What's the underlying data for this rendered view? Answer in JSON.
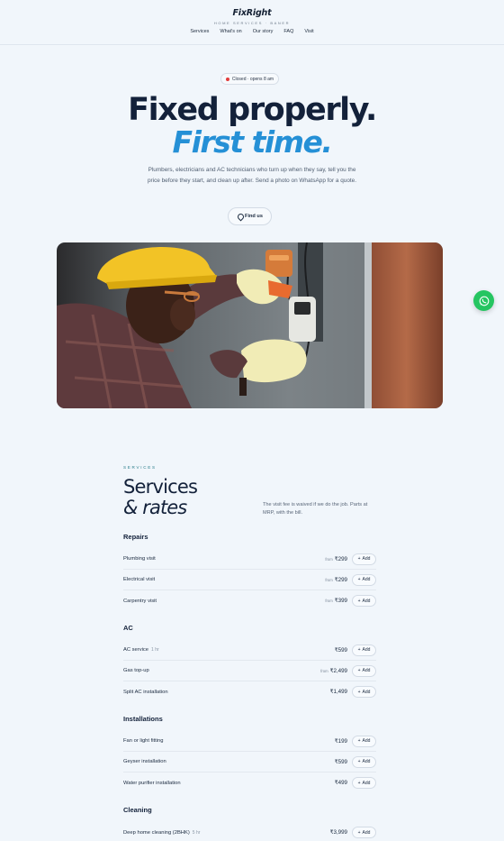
{
  "header": {
    "logo": "FixRight",
    "tagline": "HOME SERVICES · BANER",
    "nav": [
      "Services",
      "What's on",
      "Our story",
      "FAQ",
      "Visit"
    ]
  },
  "hero": {
    "status": "Closed · opens 8 am",
    "headline_1": "Fixed properly.",
    "headline_2": "First time.",
    "intro": "Plumbers, electricians and AC technicians who turn up when they say, tell you the price before they start, and clean up after. Send a photo on WhatsApp for a quote.",
    "find_us": "Find us"
  },
  "services": {
    "eyebrow": "SERVICES",
    "title_1": "Services",
    "title_2": "& rates",
    "note": "The visit fee is waived if we do the job. Parts at MRP, with the bill.",
    "add_label": "Add",
    "groups": [
      {
        "title": "Repairs",
        "items": [
          {
            "name": "Plumbing visit",
            "duration": "",
            "from": "from",
            "price": "₹299"
          },
          {
            "name": "Electrical visit",
            "duration": "",
            "from": "from",
            "price": "₹299"
          },
          {
            "name": "Carpentry visit",
            "duration": "",
            "from": "from",
            "price": "₹399"
          }
        ]
      },
      {
        "title": "AC",
        "items": [
          {
            "name": "AC service",
            "duration": "1 hr",
            "from": "",
            "price": "₹599"
          },
          {
            "name": "Gas top-up",
            "duration": "",
            "from": "from",
            "price": "₹2,499"
          },
          {
            "name": "Split AC installation",
            "duration": "",
            "from": "",
            "price": "₹1,499"
          }
        ]
      },
      {
        "title": "Installations",
        "items": [
          {
            "name": "Fan or light fitting",
            "duration": "",
            "from": "",
            "price": "₹199"
          },
          {
            "name": "Geyser installation",
            "duration": "",
            "from": "",
            "price": "₹599"
          },
          {
            "name": "Water purifier installation",
            "duration": "",
            "from": "",
            "price": "₹499"
          }
        ]
      },
      {
        "title": "Cleaning",
        "items": [
          {
            "name": "Deep home cleaning (2BHK)",
            "duration": "5 hr",
            "from": "",
            "price": "₹3,999"
          }
        ]
      }
    ]
  },
  "colors": {
    "accent": "#2590d6",
    "whatsapp": "#25c561",
    "status_closed": "#e23b3b",
    "background": "#f1f6fb"
  },
  "icons": {
    "location": "pin-icon",
    "whatsapp": "whatsapp-icon",
    "add": "plus-icon"
  }
}
